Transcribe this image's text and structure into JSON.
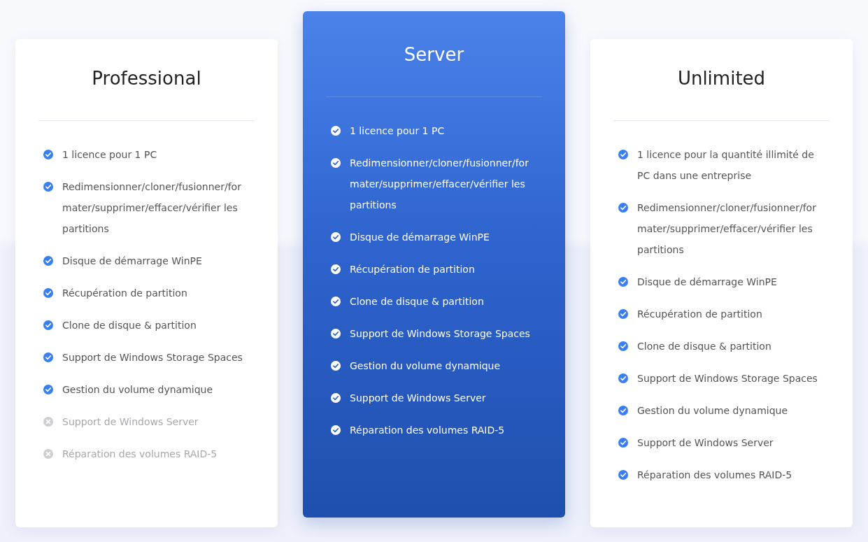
{
  "plans": [
    {
      "name": "Professional",
      "featured": false,
      "features": [
        {
          "text": "1 licence pour 1 PC",
          "included": true
        },
        {
          "text": "Redimensionner/cloner/fusionner/formater/supprimer/effacer/vérifier les partitions",
          "included": true
        },
        {
          "text": "Disque de démarrage WinPE",
          "included": true
        },
        {
          "text": "Récupération de partition",
          "included": true
        },
        {
          "text": "Clone de disque & partition",
          "included": true
        },
        {
          "text": "Support de Windows Storage Spaces",
          "included": true
        },
        {
          "text": "Gestion du volume dynamique",
          "included": true
        },
        {
          "text": "Support de Windows Server",
          "included": false
        },
        {
          "text": "Réparation des volumes RAID-5",
          "included": false
        }
      ]
    },
    {
      "name": "Server",
      "featured": true,
      "features": [
        {
          "text": "1 licence pour 1 PC",
          "included": true
        },
        {
          "text": "Redimensionner/cloner/fusionner/formater/supprimer/effacer/vérifier les partitions",
          "included": true
        },
        {
          "text": "Disque de démarrage WinPE",
          "included": true
        },
        {
          "text": "Récupération de partition",
          "included": true
        },
        {
          "text": "Clone de disque & partition",
          "included": true
        },
        {
          "text": "Support de Windows Storage Spaces",
          "included": true
        },
        {
          "text": "Gestion du volume dynamique",
          "included": true
        },
        {
          "text": "Support de Windows Server",
          "included": true
        },
        {
          "text": "Réparation des volumes RAID-5",
          "included": true
        }
      ]
    },
    {
      "name": "Unlimited",
      "featured": false,
      "features": [
        {
          "text": "1 licence pour la quantité illimité de PC dans une entreprise",
          "included": true
        },
        {
          "text": "Redimensionner/cloner/fusionner/formater/supprimer/effacer/vérifier les partitions",
          "included": true
        },
        {
          "text": "Disque de démarrage WinPE",
          "included": true
        },
        {
          "text": "Récupération de partition",
          "included": true
        },
        {
          "text": "Clone de disque & partition",
          "included": true
        },
        {
          "text": "Support de Windows Storage Spaces",
          "included": true
        },
        {
          "text": "Gestion du volume dynamique",
          "included": true
        },
        {
          "text": "Support de Windows Server",
          "included": true
        },
        {
          "text": "Réparation des volumes RAID-5",
          "included": true
        }
      ]
    }
  ]
}
